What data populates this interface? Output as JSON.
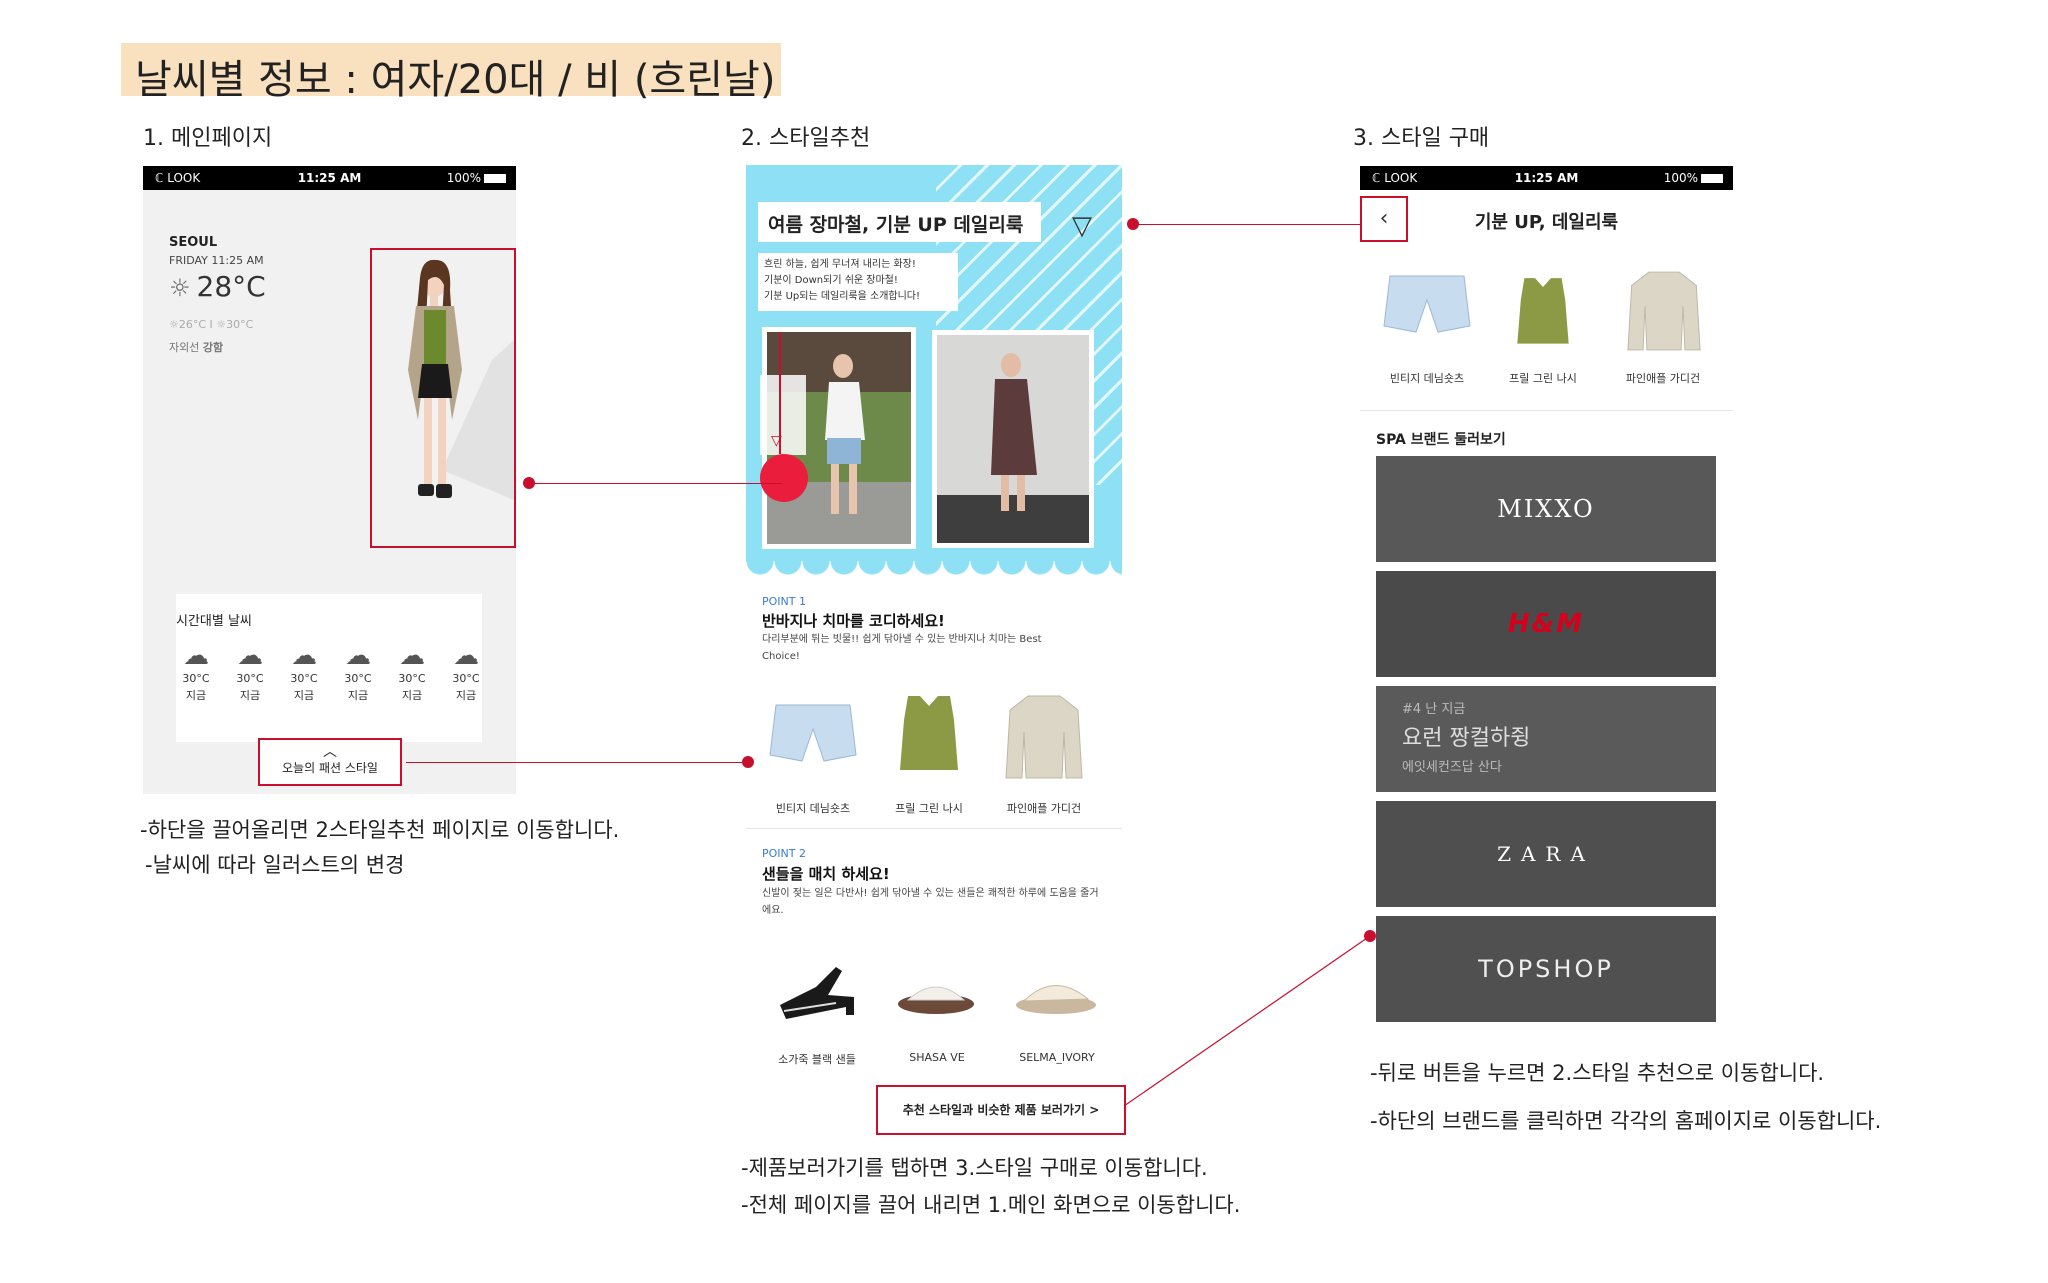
{
  "header": {
    "title": "날씨별 정보 : 여자/20대 / 비 (흐린날)"
  },
  "sections": [
    {
      "heading": "1. 메인페이지"
    },
    {
      "heading": "2. 스타일추천"
    },
    {
      "heading": "3. 스타일 구매"
    }
  ],
  "statusbar": {
    "carrier": "ℂ LOOK",
    "time": "11:25 AM",
    "battery": "100%"
  },
  "main_page": {
    "city": "SEOUL",
    "date": "FRIDAY  11:25 AM",
    "temperature": "28°C",
    "range": "☼26°C  I  ☼30°C",
    "uv_label": "자외선",
    "uv_value": "강함",
    "hourly_title": "시간대별 날씨",
    "hourly": [
      {
        "temp": "30°C",
        "time": "지금"
      },
      {
        "temp": "30°C",
        "time": "지금"
      },
      {
        "temp": "30°C",
        "time": "지금"
      },
      {
        "temp": "30°C",
        "time": "지금"
      },
      {
        "temp": "30°C",
        "time": "지금"
      },
      {
        "temp": "30°C",
        "time": "지금"
      }
    ],
    "today_button": "오늘의 패션 스타일"
  },
  "notes_1": [
    "-하단을 끌어올리면 2스타일추천 페이지로 이동합니다.",
    "-날씨에 따라 일러스트의 변경"
  ],
  "style_page": {
    "title": "여름 장마철, 기분 UP 데일리룩",
    "desc": [
      "흐린 하늘, 쉽게 무너져 내리는 화장!",
      "기분이 Down되기 쉬운 장마철!",
      "기분 Up되는 데일리룩을 소개합니다!"
    ],
    "point1": {
      "label": "POINT 1",
      "headline": "반바지나 치마를 코디하세요!",
      "desc": "다리부분에 튀는 빗물!! 쉽게 닦아낼 수 있는 반바지나 치마는 Best Choice!",
      "products": [
        "빈티지 데님숏츠",
        "프릴 그린 나시",
        "파인애플 가디건"
      ]
    },
    "point2": {
      "label": "POINT 2",
      "headline": "샌들을 매치 하세요!",
      "desc": "신발이 젖는 일은 다반사! 쉽게 닦아낼 수 있는 샌들은 쾌적한 하루에 도움을 줄거에요.",
      "products": [
        "소가죽 블랙 샌들",
        "SHASA VE",
        "SELMA_IVORY"
      ]
    },
    "view_button": "추천 스타일과 비슷한 제품 보러가기 >"
  },
  "notes_2": [
    "-제품보러가기를 탭하면 3.스타일 구매로 이동합니다.",
    "-전체 페이지를 끌어 내리면 1.메인 화면으로 이동합니다."
  ],
  "purchase_page": {
    "back": "‹",
    "title": "기분 UP,  데일리룩",
    "products": [
      "빈티지 데님숏츠",
      "프릴 그린 나시",
      "파인애플 가디건"
    ],
    "spa_title": "SPA 브랜드 둘러보기",
    "brands": [
      "MIXXO",
      "H&M",
      "ZARA",
      "TOPSHOP"
    ],
    "banner_text": [
      "#4 난 지금",
      "요런 짱컬하쥥",
      "에잇세컨즈답 산다"
    ]
  },
  "notes_3": [
    "-뒤로 버튼을 누르면 2.스타일 추천으로 이동합니다.",
    "-하단의 브랜드를 클릭하면 각각의 홈페이지로 이동합니다."
  ],
  "colors": {
    "accent_red": "#c8102e",
    "hero_blue": "#8ee0f5",
    "title_bg": "#f9e0be",
    "point_blue": "#3a7bd5"
  }
}
